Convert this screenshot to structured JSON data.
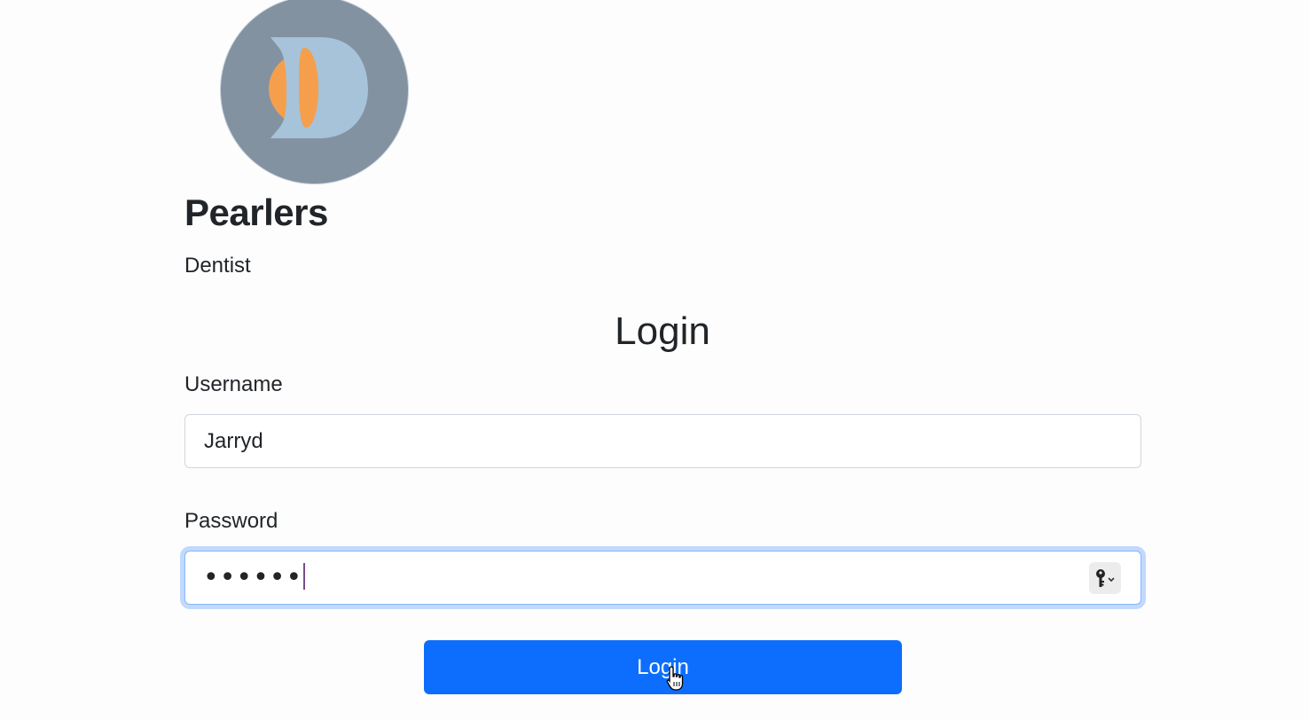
{
  "brand": {
    "name": "Pearlers",
    "type": "Dentist",
    "logo_icon": "tooth-logo-icon",
    "logo_colors": {
      "background": "#8392a1",
      "letter": "#a6c3da",
      "accent": "#f59f4c"
    }
  },
  "login_form": {
    "heading": "Login",
    "username_label": "Username",
    "username_value": "Jarryd",
    "password_label": "Password",
    "password_value": "••••••",
    "password_manager_icon": "key-icon",
    "submit_label": "Login"
  },
  "colors": {
    "primary": "#0d6efd",
    "focus_ring": "#c2d9fc",
    "text": "#212529"
  }
}
